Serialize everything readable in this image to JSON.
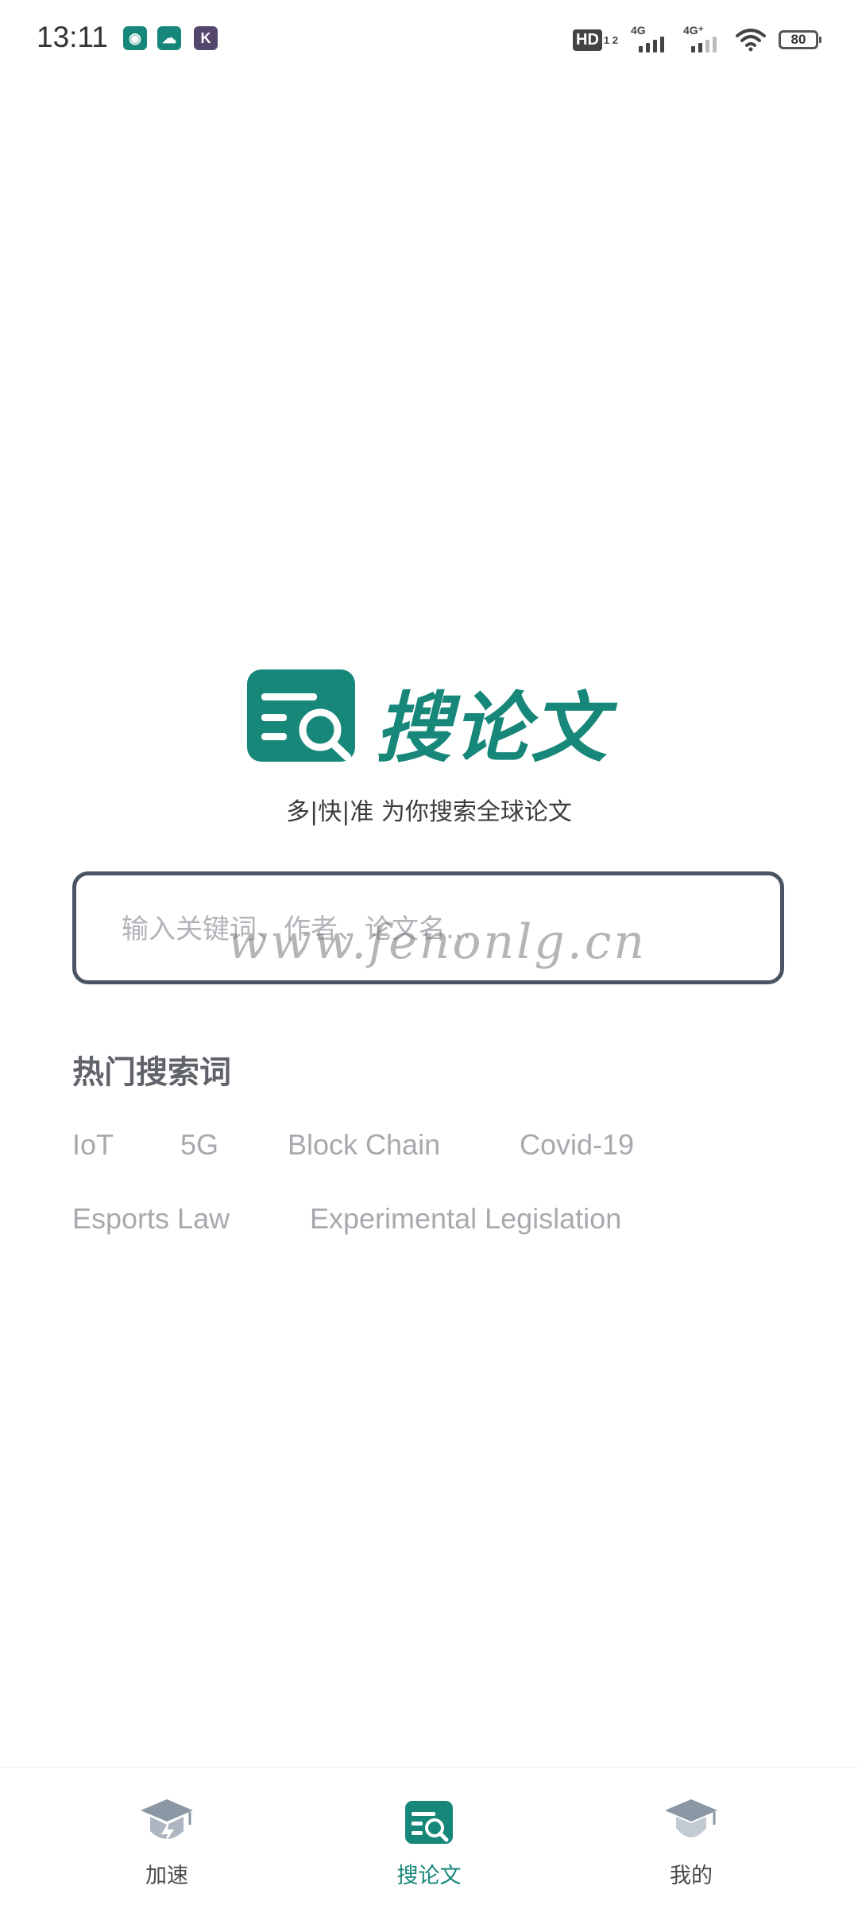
{
  "status_bar": {
    "time": "13:11",
    "notif_icons": [
      "bear-app-icon",
      "cloud-app-icon",
      "k-app-icon"
    ],
    "hd_label": "HD",
    "hd_sub": "1 2",
    "signal1_label": "4G",
    "signal2_label": "4G⁺",
    "battery": "80"
  },
  "logo": {
    "brand": "搜论文",
    "tagline": "多|快|准 为你搜索全球论文",
    "color": "#17877a"
  },
  "search": {
    "placeholder": "输入关键词、作者、论文名..."
  },
  "watermark": "www.fenonlg.cn",
  "hot": {
    "title": "热门搜索词",
    "tags": [
      "IoT",
      "5G",
      "Block Chain",
      "Covid-19",
      "Esports Law",
      "Experimental Legislation"
    ]
  },
  "bottom_nav": {
    "items": [
      {
        "label": "加速",
        "icon": "graduation-cap-speed-icon",
        "active": false
      },
      {
        "label": "搜论文",
        "icon": "paper-search-icon",
        "active": true
      },
      {
        "label": "我的",
        "icon": "graduate-avatar-icon",
        "active": false
      }
    ]
  }
}
